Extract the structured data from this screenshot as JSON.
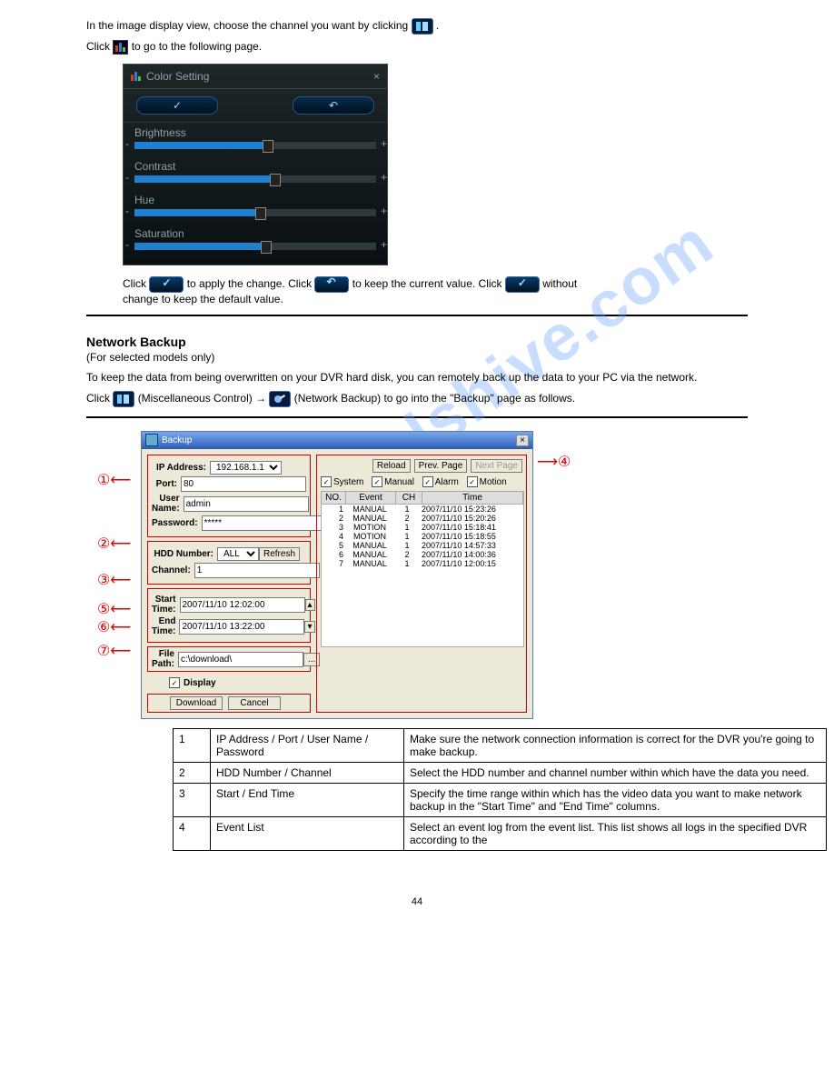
{
  "watermark": "manualshive.com",
  "section1": {
    "text1a": "In the image display view, choose the channel you want by clicking ",
    "text1b": ".",
    "text2a": "Click ",
    "text2b": " to go to the following page."
  },
  "color_panel": {
    "title": "Color Setting",
    "rows": [
      "Brightness",
      "Contrast",
      "Hue",
      "Saturation"
    ],
    "fills": [
      "55%",
      "58%",
      "52%",
      "54%"
    ]
  },
  "below_panel": {
    "p1a": "Click ",
    "p1b": " to apply the change. Click ",
    "p1c": " to keep the current value. Click ",
    "p1d": " without",
    "p2": "change to keep the default value."
  },
  "section2": {
    "heading": "Network Backup",
    "p1": "(For selected models only)",
    "p2": "To keep the data from being overwritten on your DVR hard disk, you can remotely back up the data to your PC via the network.",
    "p3a": "Click ",
    "p3b": " (Miscellaneous Control) → ",
    "p3c": " (Network Backup) to go into the \"Backup\" page as follows."
  },
  "backup": {
    "title": "Backup",
    "ip_label": "IP Address:",
    "ip_value": "192.168.1.1",
    "port_label": "Port:",
    "port_value": "80",
    "user_label": "User Name:",
    "user_value": "admin",
    "pass_label": "Password:",
    "pass_value": "*****",
    "hdd_label": "HDD Number:",
    "hdd_value": "ALL",
    "refresh": "Refresh",
    "channel_label": "Channel:",
    "channel_value": "1",
    "start_label": "Start Time:",
    "start_value": "2007/11/10 12:02:00",
    "end_label": "End Time:",
    "end_value": "2007/11/10 13:22:00",
    "file_label": "File Path:",
    "file_value": "c:\\download\\",
    "display_label": "Display",
    "download": "Download",
    "cancel": "Cancel",
    "reload": "Reload",
    "prev": "Prev. Page",
    "next": "Next Page",
    "check_system": "System",
    "check_manual": "Manual",
    "check_alarm": "Alarm",
    "check_motion": "Motion",
    "headers": {
      "no": "NO.",
      "event": "Event",
      "ch": "CH",
      "time": "Time"
    },
    "rows": [
      {
        "no": "1",
        "event": "MANUAL",
        "ch": "1",
        "time": "2007/11/10 15:23:26"
      },
      {
        "no": "2",
        "event": "MANUAL",
        "ch": "2",
        "time": "2007/11/10 15:20:26"
      },
      {
        "no": "3",
        "event": "MOTION",
        "ch": "1",
        "time": "2007/11/10 15:18:41"
      },
      {
        "no": "4",
        "event": "MOTION",
        "ch": "1",
        "time": "2007/11/10 15:18:55"
      },
      {
        "no": "5",
        "event": "MANUAL",
        "ch": "1",
        "time": "2007/11/10 14:57:33"
      },
      {
        "no": "6",
        "event": "MANUAL",
        "ch": "2",
        "time": "2007/11/10 14:00:36"
      },
      {
        "no": "7",
        "event": "MANUAL",
        "ch": "1",
        "time": "2007/11/10 12:00:15"
      }
    ]
  },
  "callouts": [
    "①",
    "②",
    "③",
    "④",
    "⑤",
    "⑥",
    "⑦"
  ],
  "desc_table": {
    "r1": [
      "1",
      "IP Address / Port / User Name / Password",
      "Make sure the network connection information is correct for the DVR you're going to make backup."
    ],
    "r2": [
      "2",
      "HDD Number / Channel",
      "Select the HDD number and channel number within which have the data you need."
    ],
    "r3": [
      "3",
      "Start / End Time",
      "Specify the time range within which has the video data you want to make network backup in the \"Start Time\" and \"End Time\" columns."
    ],
    "r4": [
      "4",
      "Event List",
      "Select an event log from the event list. This list shows all logs in the specified DVR according to the"
    ]
  },
  "page_number": "44"
}
